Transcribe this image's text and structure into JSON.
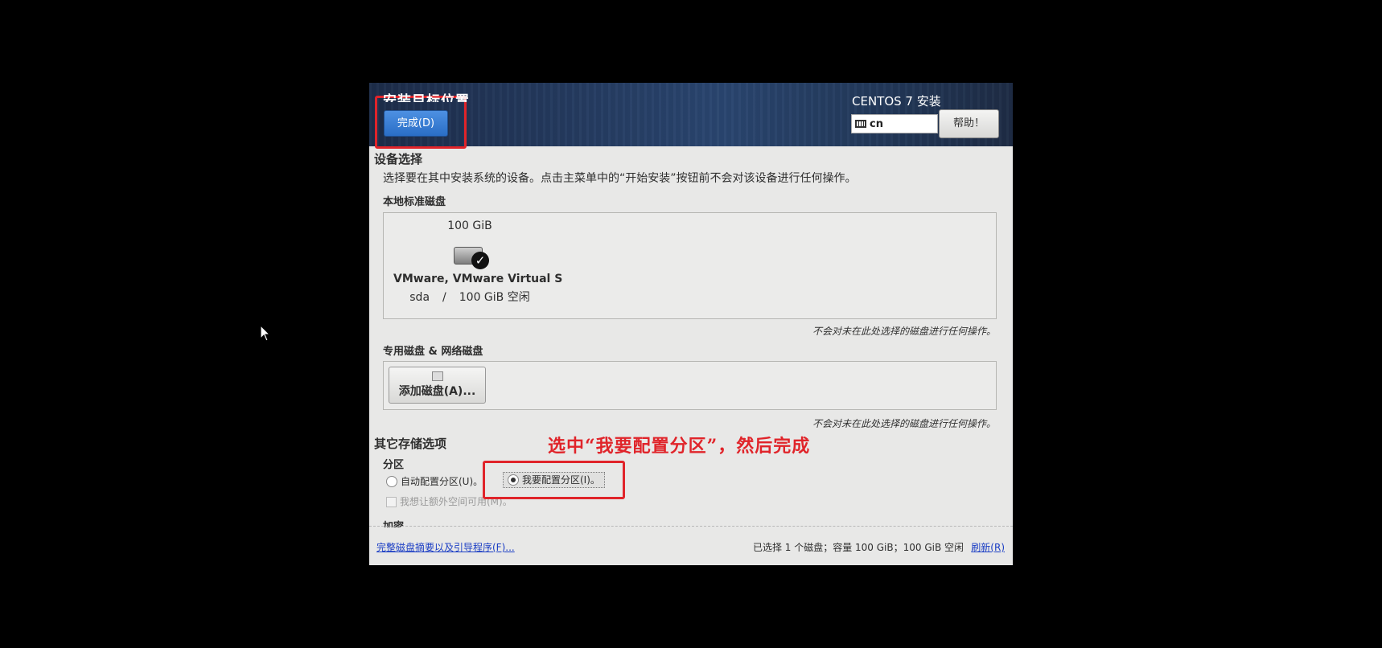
{
  "header": {
    "spoke_title": "安装目标位置",
    "done_label": "完成(D)",
    "product_title": "CENTOS 7 安装",
    "keyboard_layout": "cn",
    "help_label": "帮助！"
  },
  "device_selection": {
    "title": "设备选择",
    "description": "选择要在其中安装系统的设备。点击主菜单中的“开始安装”按钮前不会对该设备进行任何操作。",
    "local_disks_title": "本地标准磁盘",
    "disk": {
      "size": "100 GiB",
      "name": "VMware, VMware Virtual S",
      "device": "sda",
      "separator": "/",
      "free": "100 GiB 空闲",
      "selected": true
    },
    "local_note": "不会对未在此处选择的磁盘进行任何操作。",
    "special_disks_title": "专用磁盘 & 网络磁盘",
    "add_disk_label": "添加磁盘(A)...",
    "special_note": "不会对未在此处选择的磁盘进行任何操作。"
  },
  "other_storage": {
    "title": "其它存储选项",
    "partitioning_title": "分区",
    "auto_partition_label": "自动配置分区(U)。",
    "manual_partition_label": "我要配置分区(I)。",
    "manual_selected": true,
    "extra_space_label": "我想让额外空间可用(M)。",
    "encryption_title": "加密"
  },
  "footer": {
    "summary_link": "完整磁盘摘要以及引导程序(F)...",
    "status": "已选择 1 个磁盘；容量 100 GiB；100 GiB 空闲",
    "refresh_link": "刷新(R)"
  },
  "annotation": {
    "text": "选中“我要配置分区”，然后完成",
    "color": "#e0242a"
  }
}
